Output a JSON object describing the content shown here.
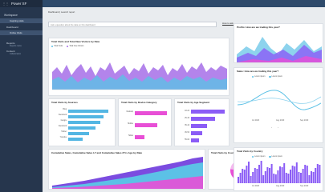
{
  "app": {
    "title": "Power SF"
  },
  "sidebar": {
    "workspace_label": "Workspace",
    "items": [
      {
        "label": "Inspiring visits",
        "active": true
      },
      {
        "label": "Dashboard",
        "active": false
      },
      {
        "label": "Online Visits",
        "active": false
      }
    ],
    "reports_label": "Reports",
    "reports_sub": "Reports name",
    "content_label": "Content",
    "content_sub": "Collaboration"
  },
  "dashboard": {
    "breadcrumb": "Dashboard | Launch report",
    "qa_placeholder": "Ask a question about the data on this dashboard",
    "howto_link": "How to ask"
  },
  "visits_by_date": {
    "title": "Total Visits and Total New Visitors by Date",
    "series": [
      {
        "name": "Total Visits",
        "color": "#5cc1e6"
      },
      {
        "name": "Total New Visitors",
        "color": "#a66ee8"
      }
    ]
  },
  "visits_by_source": {
    "title": "Total Visits by Sources",
    "categories": [
      "Bing",
      "Facebook",
      "Google",
      "Facebook",
      "Twitter",
      "Youtube"
    ]
  },
  "visits_by_device": {
    "title": "Total Visits by Device Category",
    "categories": [
      "Desktop",
      "Mobile",
      "Tablet"
    ]
  },
  "visits_by_age": {
    "title": "Total Visits by Age Segment",
    "categories": [
      "18-24",
      "25-34",
      "35-44",
      "45-54",
      "55-64"
    ]
  },
  "cumulative_sales": {
    "title": "Cumulative Sales, Cumulative Sales LY and Cumulative Sales 2Yrs Ago by Date"
  },
  "visits_by_country": {
    "title": "Total Visits by Country"
  },
  "profits": {
    "title": "Profits: How are we trading this year?"
  },
  "sales": {
    "title": "Sales: How are we trading this year?",
    "legend": [
      "Lorem ipsum",
      "Lorem ipsum"
    ],
    "x_ticks": [
      "Jul 2020",
      "Aug 2020",
      "Sep 2020"
    ]
  },
  "visits_by_country_bar": {
    "title": "Total Visits by Country",
    "legend": [
      "Lorem ipsum",
      "Lorem ipsum"
    ],
    "x_ticks": [
      "Jul 2020",
      "Aug 2020",
      "Sep 2020"
    ]
  },
  "colors": {
    "sidebar": "#26364d",
    "accent_blue": "#5cc1e6",
    "accent_purple": "#8b5cf6",
    "accent_pink": "#e84fd6",
    "bar_blue": "#54b6e3"
  }
}
